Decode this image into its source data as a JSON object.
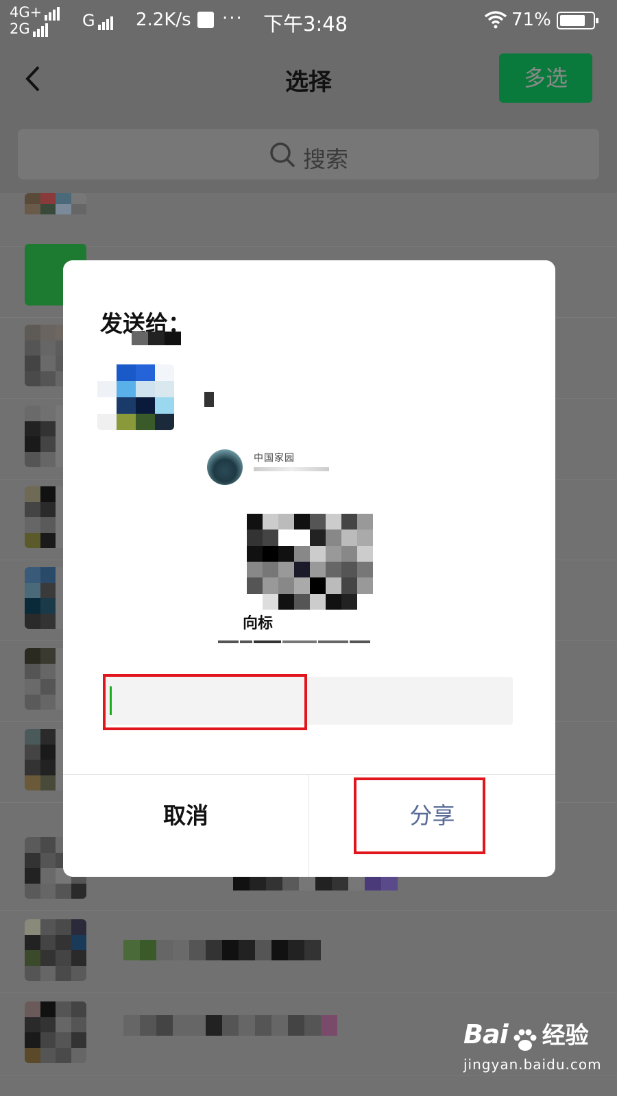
{
  "status_bar": {
    "network_top": "4G+",
    "network_bottom": "2G",
    "network_g": "G",
    "speed": "2.2K/s",
    "dots": "···",
    "time": "下午3:48",
    "battery_percent": "71%",
    "battery_level": 0.71
  },
  "nav": {
    "title": "选择",
    "multi_select_label": "多选"
  },
  "search": {
    "placeholder": "搜索"
  },
  "dialog": {
    "send_to_label": "发送给：",
    "card_caption": "向标",
    "card_account_name": "中国家园",
    "message_input_value": "",
    "cancel_label": "取消",
    "share_label": "分享"
  },
  "colors": {
    "accent_green": "#1aad19",
    "multi_button_green": "#0a7a3c",
    "share_blue": "#576b95",
    "highlight_red": "#e0161c"
  },
  "watermark": {
    "brand_left": "Bai",
    "brand_right": "经验",
    "url": "jingyan.baidu.com"
  }
}
